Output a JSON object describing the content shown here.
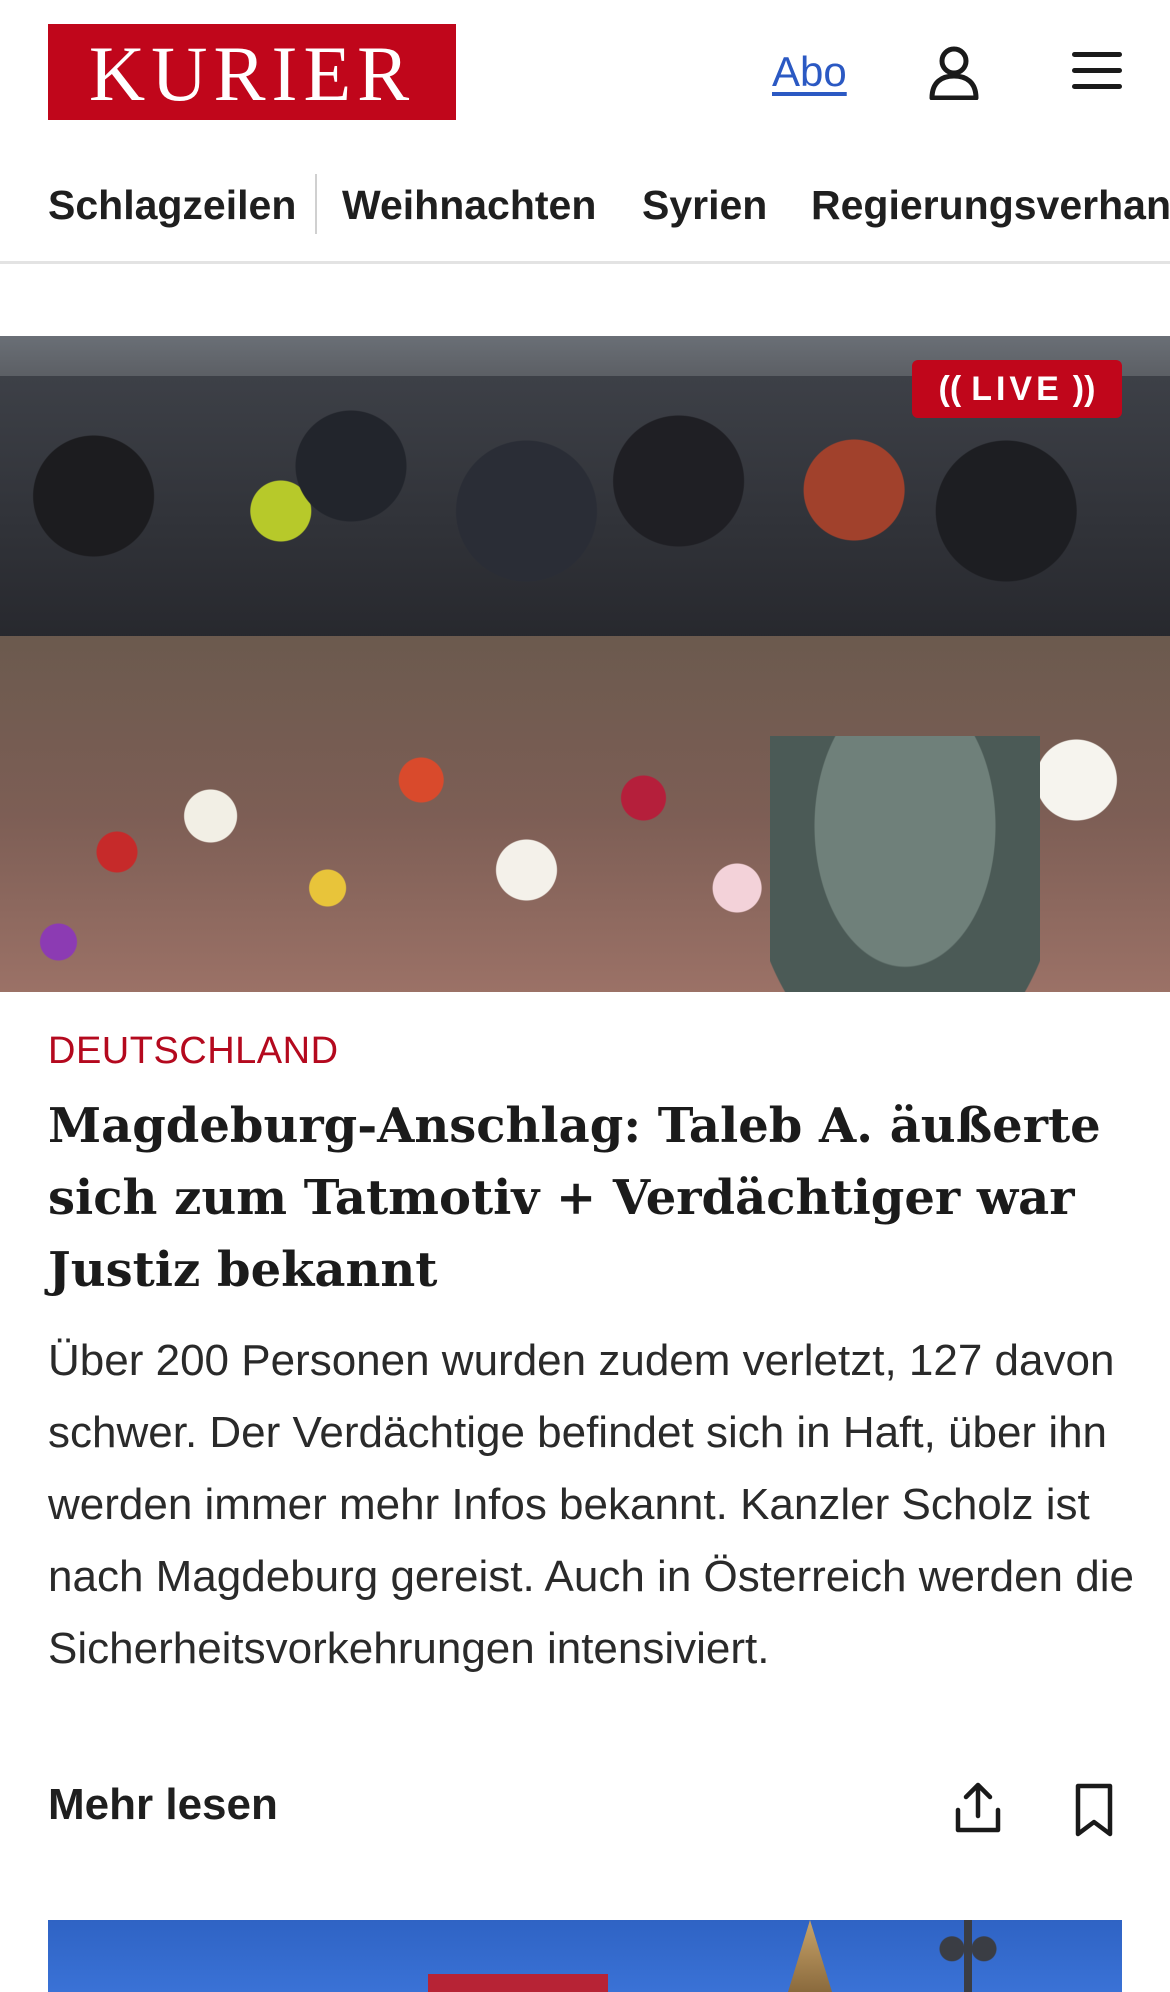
{
  "header": {
    "logo_text": "KURIER",
    "abo_label": "Abo",
    "user_icon": "user-icon",
    "menu_icon": "hamburger-menu-icon"
  },
  "nav": {
    "items": [
      "Schlagzeilen",
      "Weihnachten",
      "Syrien",
      "Regierungsverhand"
    ]
  },
  "article": {
    "live_label": "LIVE",
    "category": "DEUTSCHLAND",
    "headline": "Magdeburg-Anschlag: Taleb A. äußerte sich zum Tatmotiv + Verdächtiger war Justiz bekannt",
    "lead": "Über 200 Personen wurden zudem verletzt, 127 davon schwer. Der Verdächtige befindet sich in Haft, über ihn werden immer mehr Infos bekannt. Kanzler Scholz ist nach Magdeburg gereist. Auch in Österreich werden die Sicherheitsvorkehrungen intensiviert.",
    "more_label": "Mehr lesen",
    "share_icon": "share-icon",
    "bookmark_icon": "bookmark-icon"
  },
  "colors": {
    "brand_red": "#c0061b",
    "link_blue": "#2b59c3",
    "kicker_red": "#b4091e"
  }
}
